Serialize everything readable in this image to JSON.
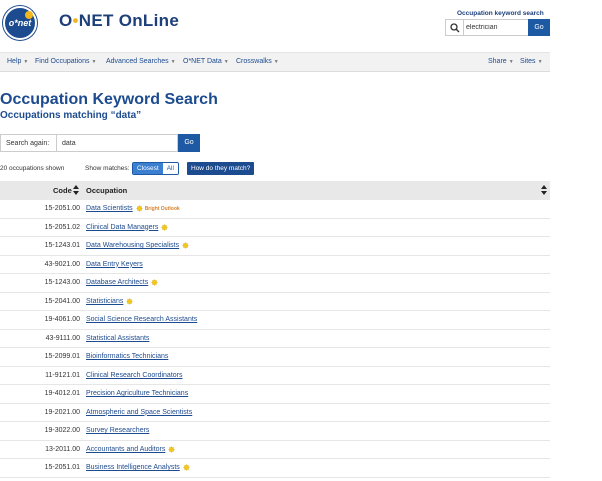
{
  "brand": {
    "logo_text": "o*net",
    "name_prefix": "O",
    "name_dot": "•",
    "name_suffix": "NET OnLine"
  },
  "top_search": {
    "label": "Occupation keyword search",
    "value": "electrician",
    "go": "Go"
  },
  "nav": {
    "left": [
      "Help",
      "Find Occupations",
      "Advanced Searches",
      "O*NET Data",
      "Crosswalks"
    ],
    "right": [
      "Share",
      "Sites"
    ]
  },
  "page": {
    "title": "Occupation Keyword Search",
    "subtitle": "Occupations matching “data”"
  },
  "search_again": {
    "label": "Search again:",
    "value": "data",
    "go": "Go"
  },
  "results": {
    "count": "20 occupations shown",
    "show_matches_label": "Show matches:",
    "toggle": [
      "Closest",
      "All"
    ],
    "how_match": "How do they match?"
  },
  "table": {
    "headers": {
      "code": "Code",
      "occupation": "Occupation"
    },
    "rows": [
      {
        "code": "15-2051.00",
        "title": "Data Scientists",
        "sun": true,
        "bright": "Bright Outlook"
      },
      {
        "code": "15-2051.02",
        "title": "Clinical Data Managers",
        "sun": true
      },
      {
        "code": "15-1243.01",
        "title": "Data Warehousing Specialists",
        "sun": true
      },
      {
        "code": "43-9021.00",
        "title": "Data Entry Keyers",
        "sun": false
      },
      {
        "code": "15-1243.00",
        "title": "Database Architects",
        "sun": true
      },
      {
        "code": "15-2041.00",
        "title": "Statisticians",
        "sun": true
      },
      {
        "code": "19-4061.00",
        "title": "Social Science Research Assistants",
        "sun": false
      },
      {
        "code": "43-9111.00",
        "title": "Statistical Assistants",
        "sun": false
      },
      {
        "code": "15-2099.01",
        "title": "Bioinformatics Technicians",
        "sun": false
      },
      {
        "code": "11-9121.01",
        "title": "Clinical Research Coordinators",
        "sun": false
      },
      {
        "code": "19-4012.01",
        "title": "Precision Agriculture Technicians",
        "sun": false
      },
      {
        "code": "19-2021.00",
        "title": "Atmospheric and Space Scientists",
        "sun": false
      },
      {
        "code": "19-3022.00",
        "title": "Survey Researchers",
        "sun": false
      },
      {
        "code": "13-2011.00",
        "title": "Accountants and Auditors",
        "sun": true
      },
      {
        "code": "15-2051.01",
        "title": "Business Intelligence Analysts",
        "sun": true
      }
    ]
  },
  "colors": {
    "brand_blue": "#1d4b8f",
    "button_blue": "#1d5aa3",
    "bright_outlook": "#d9822b",
    "sun": "#f2c81c"
  }
}
